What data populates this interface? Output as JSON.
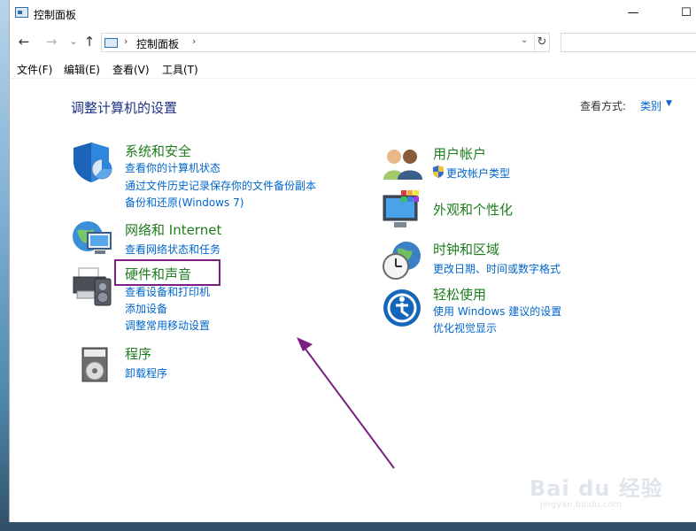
{
  "window": {
    "title": "控制面板",
    "minimize": "—",
    "maximize": "☐"
  },
  "nav": {
    "back": "←",
    "forward": "→",
    "recent": "⌄",
    "up": "↑",
    "breadcrumb": "控制面板",
    "refresh": "↻",
    "search_placeholder": ""
  },
  "menus": [
    "文件(F)",
    "编辑(E)",
    "查看(V)",
    "工具(T)"
  ],
  "content": {
    "heading": "调整计算机的设置",
    "view_label": "查看方式:",
    "view_value": "类别"
  },
  "categories": [
    {
      "title": "系统和安全",
      "icon": "shield-icon",
      "links": [
        "查看你的计算机状态",
        "通过文件历史记录保存你的文件备份副本",
        "备份和还原(Windows 7)"
      ]
    },
    {
      "title": "网络和 Internet",
      "icon": "network-globe-icon",
      "links": [
        "查看网络状态和任务"
      ]
    },
    {
      "title": "硬件和声音",
      "icon": "printer-speaker-icon",
      "links": [
        "查看设备和打印机",
        "添加设备",
        "调整常用移动设置"
      ]
    },
    {
      "title": "程序",
      "icon": "programs-disc-icon",
      "links": [
        "卸载程序"
      ]
    },
    {
      "title": "用户帐户",
      "icon": "users-icon",
      "links": [
        "更改帐户类型"
      ]
    },
    {
      "title": "外观和个性化",
      "icon": "monitor-palette-icon",
      "links": []
    },
    {
      "title": "时钟和区域",
      "icon": "clock-globe-icon",
      "links": [
        "更改日期、时间或数字格式"
      ]
    },
    {
      "title": "轻松使用",
      "icon": "ease-of-access-icon",
      "links": [
        "使用 Windows 建议的设置",
        "优化视觉显示"
      ]
    }
  ],
  "colors": {
    "heading": "#1e3287",
    "category_title": "#1e7e1e",
    "link": "#0066cc",
    "highlight_box": "#7b1f80"
  },
  "watermark": {
    "text": "Bai du 经验",
    "url": "jingyan.baidu.com"
  }
}
